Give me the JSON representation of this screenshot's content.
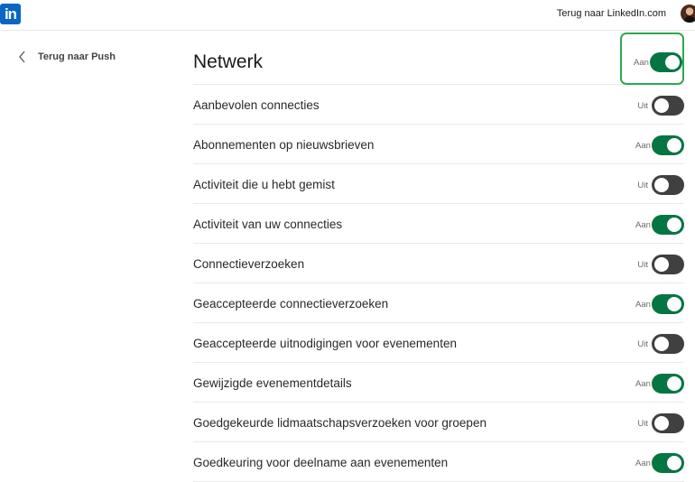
{
  "header": {
    "logo_text": "in",
    "back_to_linkedin": "Terug naar LinkedIn.com"
  },
  "sidenav": {
    "back_label": "Terug naar Push"
  },
  "section": {
    "title": "Netwerk",
    "state_label": "Aan",
    "enabled": true
  },
  "rows": [
    {
      "label": "Aanbevolen connecties",
      "state_label": "Uit",
      "enabled": false
    },
    {
      "label": "Abonnementen op nieuwsbrieven",
      "state_label": "Aan",
      "enabled": true
    },
    {
      "label": "Activiteit die u hebt gemist",
      "state_label": "Uit",
      "enabled": false
    },
    {
      "label": "Activiteit van uw connecties",
      "state_label": "Aan",
      "enabled": true
    },
    {
      "label": "Connectieverzoeken",
      "state_label": "Uit",
      "enabled": false
    },
    {
      "label": "Geaccepteerde connectieverzoeken",
      "state_label": "Aan",
      "enabled": true
    },
    {
      "label": "Geaccepteerde uitnodigingen voor evenementen",
      "state_label": "Uit",
      "enabled": false
    },
    {
      "label": "Gewijzigde evenementdetails",
      "state_label": "Aan",
      "enabled": true
    },
    {
      "label": "Goedgekeurde lidmaatschapsverzoeken voor groepen",
      "state_label": "Uit",
      "enabled": false
    },
    {
      "label": "Goedkeuring voor deelname aan evenementen",
      "state_label": "Aan",
      "enabled": true
    }
  ],
  "colors": {
    "brand": "#0a66c2",
    "toggle_on": "#057642",
    "toggle_off": "#404040",
    "highlight": "#2fa84f"
  }
}
